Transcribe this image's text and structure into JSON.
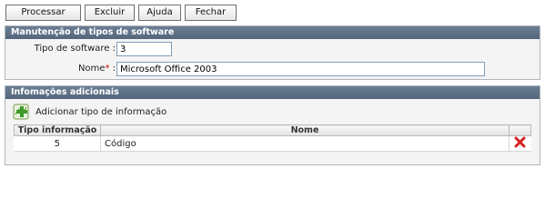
{
  "toolbar": {
    "buttons": [
      "Processar",
      "Excluir",
      "Ajuda",
      "Fechar"
    ]
  },
  "maintenance": {
    "title": "Manutenção de tipos de software",
    "type_label": "Tipo de software :",
    "type_value": "3",
    "name_label": "Nome",
    "name_required_mark": "*",
    "name_suffix": " :",
    "name_value": "Microsoft Office 2003"
  },
  "extra_info": {
    "title": "Infomações adicionais",
    "add_label": "Adicionar tipo de informação",
    "columns": [
      "Tipo informação",
      "Nome"
    ],
    "rows": [
      {
        "tipo": "5",
        "nome": "Código"
      }
    ]
  },
  "colors": {
    "section_header": "#5f7287",
    "required": "#d00000",
    "delete": "#d42020"
  },
  "icons": {
    "add": "add-plus-icon",
    "delete": "delete-x-icon"
  }
}
